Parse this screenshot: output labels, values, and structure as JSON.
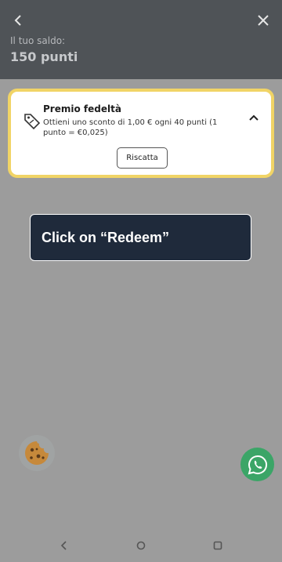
{
  "header": {
    "balance_label": "Il tuo saldo:",
    "balance_value": "150 punti",
    "icons": [
      "back-arrow",
      "close-x"
    ]
  },
  "reward_card": {
    "title": "Premio fedeltà",
    "description": "Ottieni uno sconto di 1,00 € ogni 40 punti (1 punto = €0,025)",
    "redeem_label": "Riscatta",
    "highlight_color": "#f1d466",
    "icons": [
      "tag-icon",
      "chevron-up-icon"
    ]
  },
  "tooltip": {
    "text": "Click on “Redeem”",
    "background": "#1f2a3b"
  },
  "floating": {
    "cookie_icon": "cookie-icon",
    "whatsapp_icon": "whatsapp-icon",
    "whatsapp_color": "#3ba567"
  },
  "navbar": {
    "icons": [
      "back-triangle",
      "home-circle",
      "recent-square"
    ]
  }
}
